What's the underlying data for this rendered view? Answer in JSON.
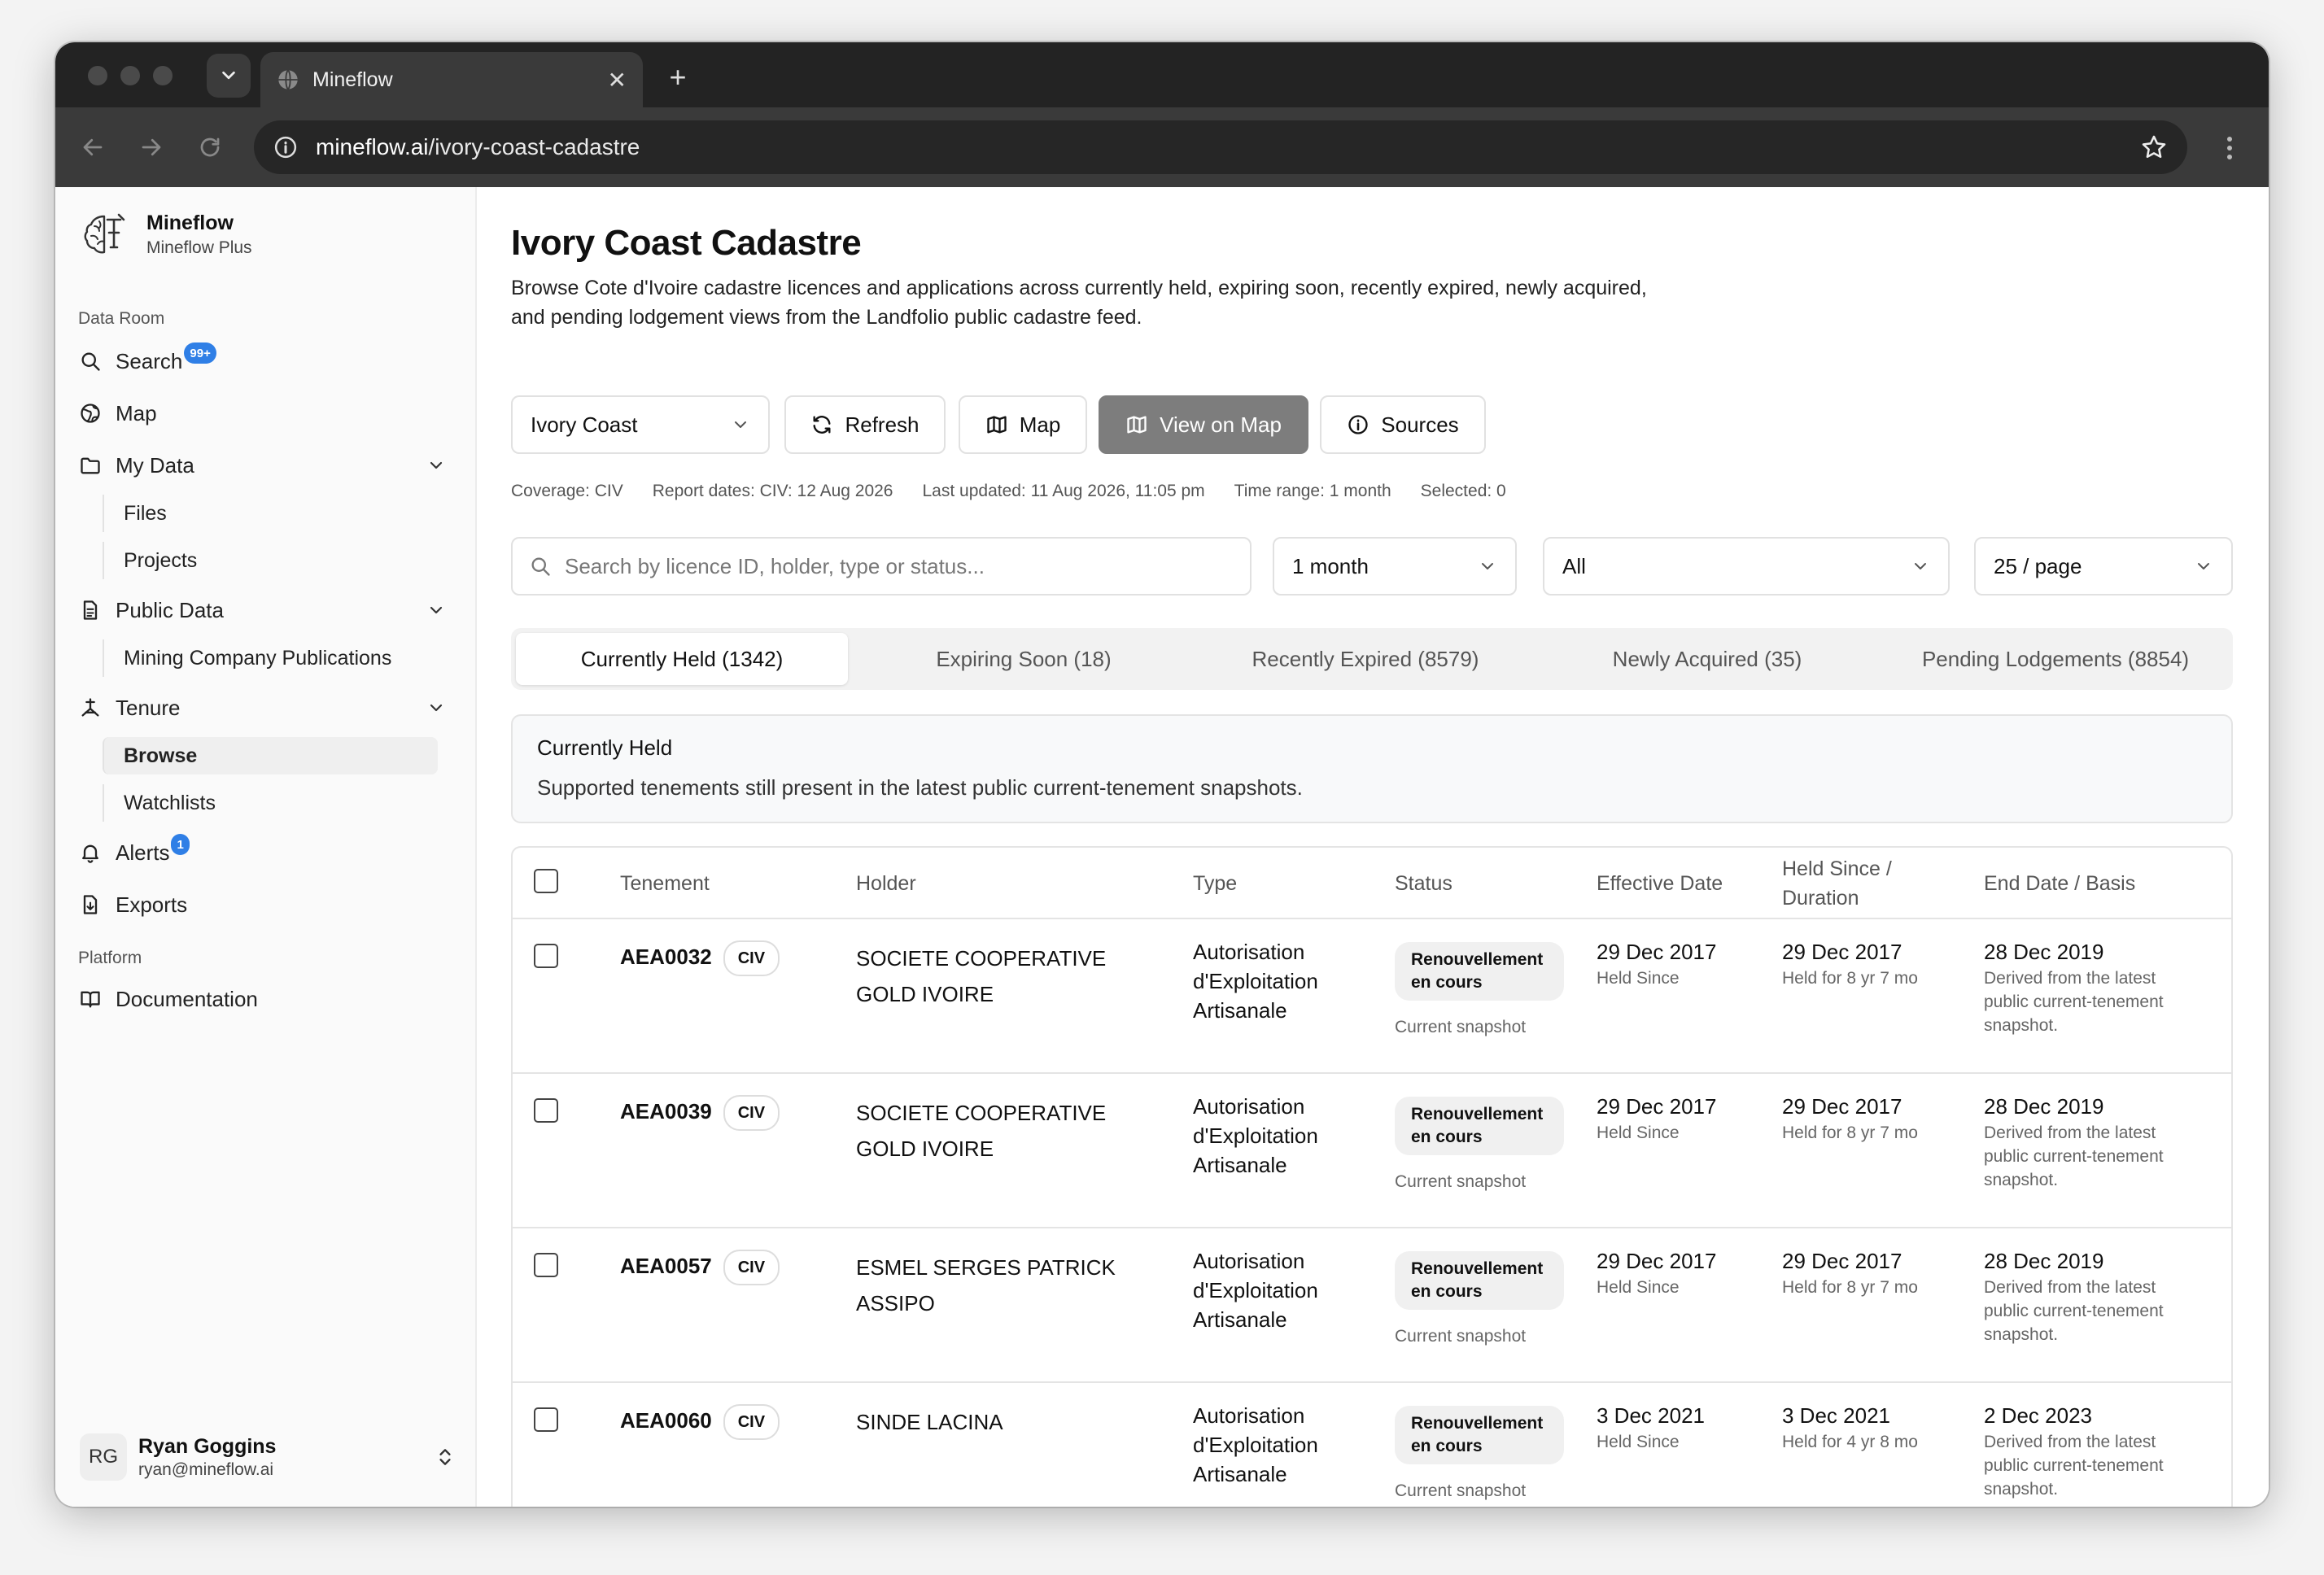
{
  "browser": {
    "tab_title": "Mineflow",
    "url_host": "mineflow.ai",
    "url_path": "/ivory-coast-cadastre"
  },
  "sidebar": {
    "brand_name": "Mineflow",
    "brand_plan": "Mineflow Plus",
    "section_data_room": "Data Room",
    "search": "Search",
    "search_badge": "99+",
    "map": "Map",
    "my_data": "My Data",
    "files": "Files",
    "projects": "Projects",
    "public_data": "Public Data",
    "mining_pubs": "Mining Company Publications",
    "tenure": "Tenure",
    "browse": "Browse",
    "watchlists": "Watchlists",
    "alerts": "Alerts",
    "alerts_badge": "1",
    "exports": "Exports",
    "section_platform": "Platform",
    "documentation": "Documentation",
    "user_initials": "RG",
    "user_name": "Ryan Goggins",
    "user_email": "ryan@mineflow.ai"
  },
  "page": {
    "title": "Ivory Coast Cadastre",
    "description": "Browse Cote d'Ivoire cadastre licences and applications across currently held, expiring soon, recently expired, newly acquired, and pending lodgement views from the Landfolio public cadastre feed.",
    "country": "Ivory Coast",
    "btn_refresh": "Refresh",
    "btn_map": "Map",
    "btn_view_on_map": "View on Map",
    "btn_sources": "Sources",
    "meta": {
      "coverage": "Coverage: CIV",
      "report_dates": "Report dates: CIV: 12 Aug 2026",
      "last_updated": "Last updated: 11 Aug 2026, 11:05 pm",
      "time_range": "Time range: 1 month",
      "selected": "Selected: 0"
    },
    "search_placeholder": "Search by licence ID, holder, type or status...",
    "filter_period": "1 month",
    "filter_status": "All",
    "filter_page_size": "25 / page",
    "tabs": [
      "Currently Held (1342)",
      "Expiring Soon (18)",
      "Recently Expired (8579)",
      "Newly Acquired (35)",
      "Pending Lodgements (8854)"
    ],
    "info_title": "Currently Held",
    "info_text": "Supported tenements still present in the latest public current-tenement snapshots."
  },
  "table": {
    "headers": {
      "tenement": "Tenement",
      "holder": "Holder",
      "type": "Type",
      "status": "Status",
      "effective": "Effective Date",
      "held_l1": "Held Since /",
      "held_l2": "Duration",
      "end": "End Date / Basis"
    },
    "rows": [
      {
        "id": "AEA0032",
        "country": "CIV",
        "holder_l1": "SOCIETE COOPERATIVE",
        "holder_l2": "GOLD IVOIRE",
        "type_l1": "Autorisation",
        "type_l2": "d'Exploitation",
        "type_l3": "Artisanale",
        "status_l1": "Renouvellement",
        "status_l2": "en cours",
        "status_note": "Current snapshot",
        "effective": "29 Dec 2017",
        "effective_note": "Held Since",
        "held": "29 Dec 2017",
        "held_note": "Held for 8 yr 7 mo",
        "end": "28 Dec 2019",
        "end_l1": "Derived from the latest",
        "end_l2": "public current-tenement",
        "end_l3": "snapshot."
      },
      {
        "id": "AEA0039",
        "country": "CIV",
        "holder_l1": "SOCIETE COOPERATIVE",
        "holder_l2": "GOLD IVOIRE",
        "type_l1": "Autorisation",
        "type_l2": "d'Exploitation",
        "type_l3": "Artisanale",
        "status_l1": "Renouvellement",
        "status_l2": "en cours",
        "status_note": "Current snapshot",
        "effective": "29 Dec 2017",
        "effective_note": "Held Since",
        "held": "29 Dec 2017",
        "held_note": "Held for 8 yr 7 mo",
        "end": "28 Dec 2019",
        "end_l1": "Derived from the latest",
        "end_l2": "public current-tenement",
        "end_l3": "snapshot."
      },
      {
        "id": "AEA0057",
        "country": "CIV",
        "holder_l1": "ESMEL SERGES PATRICK",
        "holder_l2": "ASSIPO",
        "type_l1": "Autorisation",
        "type_l2": "d'Exploitation",
        "type_l3": "Artisanale",
        "status_l1": "Renouvellement",
        "status_l2": "en cours",
        "status_note": "Current snapshot",
        "effective": "29 Dec 2017",
        "effective_note": "Held Since",
        "held": "29 Dec 2017",
        "held_note": "Held for 8 yr 7 mo",
        "end": "28 Dec 2019",
        "end_l1": "Derived from the latest",
        "end_l2": "public current-tenement",
        "end_l3": "snapshot."
      },
      {
        "id": "AEA0060",
        "country": "CIV",
        "holder_l1": "SINDE LACINA",
        "holder_l2": "",
        "type_l1": "Autorisation",
        "type_l2": "d'Exploitation",
        "type_l3": "Artisanale",
        "status_l1": "Renouvellement",
        "status_l2": "en cours",
        "status_note": "Current snapshot",
        "effective": "3 Dec 2021",
        "effective_note": "Held Since",
        "held": "3 Dec 2021",
        "held_note": "Held for 4 yr 8 mo",
        "end": "2 Dec 2023",
        "end_l1": "Derived from the latest",
        "end_l2": "public current-tenement",
        "end_l3": "snapshot."
      }
    ]
  }
}
